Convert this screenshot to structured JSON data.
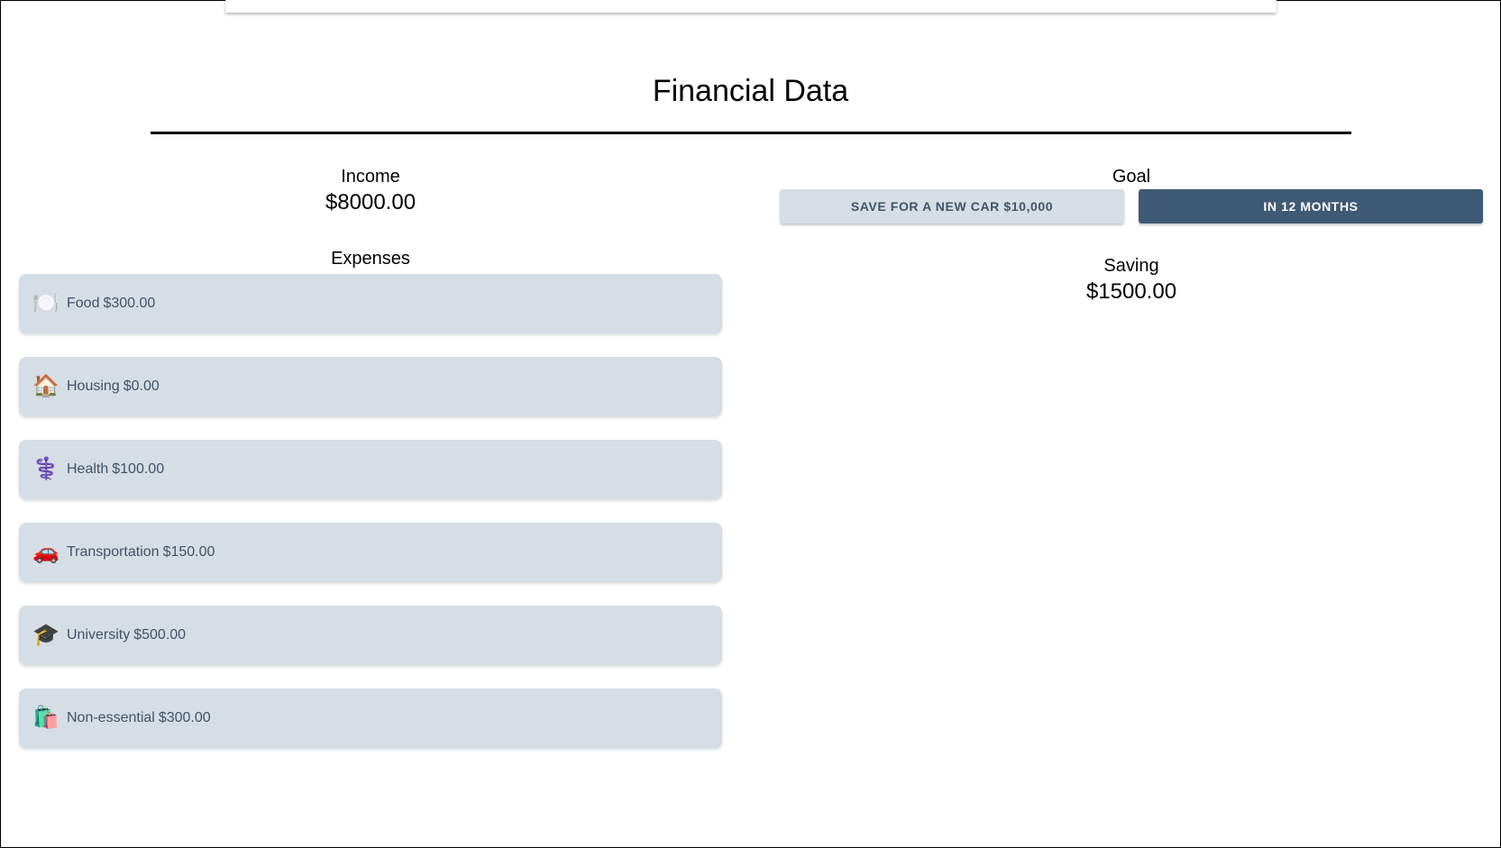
{
  "page": {
    "title": "Financial Data"
  },
  "income": {
    "label": "Income",
    "value": "$8000.00"
  },
  "expenses": {
    "label": "Expenses",
    "items": [
      {
        "icon": "plate-icon",
        "glyph": "🍽️",
        "name": "Food",
        "amount": "$300.00"
      },
      {
        "icon": "house-icon",
        "glyph": "🏠",
        "name": "Housing",
        "amount": "$0.00"
      },
      {
        "icon": "medical-icon",
        "glyph": "⚕️",
        "name": "Health",
        "amount": "$100.00"
      },
      {
        "icon": "car-icon",
        "glyph": "🚗",
        "name": "Transportation",
        "amount": "$150.00"
      },
      {
        "icon": "graduation-cap-icon",
        "glyph": "🎓",
        "name": "University",
        "amount": "$500.00"
      },
      {
        "icon": "shopping-bags-icon",
        "glyph": "🛍️",
        "name": "Non-essential",
        "amount": "$300.00"
      }
    ]
  },
  "goal": {
    "label": "Goal",
    "goal_button": "Save for a new car $10,000",
    "timeframe_button": "In 12 months"
  },
  "saving": {
    "label": "Saving",
    "value": "$1500.00"
  },
  "colors": {
    "card_background": "#d5dde5",
    "card_text": "#3f5468",
    "primary_button": "#3f5a74"
  }
}
